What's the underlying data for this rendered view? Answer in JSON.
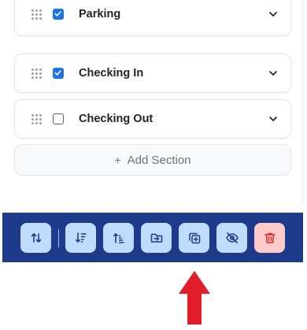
{
  "sections": [
    {
      "label": "Parking",
      "checked": true
    },
    {
      "label": "Checking In",
      "checked": true
    },
    {
      "label": "Checking Out",
      "checked": false
    }
  ],
  "add_section": {
    "plus": "+",
    "label": "Add Section"
  },
  "toolbar": {
    "background": "#1e3a8a",
    "buttons": [
      {
        "icon": "swap-vertical-icon"
      },
      {
        "icon": "sort-descending-icon"
      },
      {
        "icon": "sort-ascending-icon"
      },
      {
        "icon": "move-to-folder-icon"
      },
      {
        "icon": "duplicate-icon"
      },
      {
        "icon": "hide-eye-off-icon"
      },
      {
        "icon": "trash-icon"
      }
    ]
  },
  "annotation": {
    "icon": "red-up-arrow",
    "color": "#e11d2a"
  }
}
